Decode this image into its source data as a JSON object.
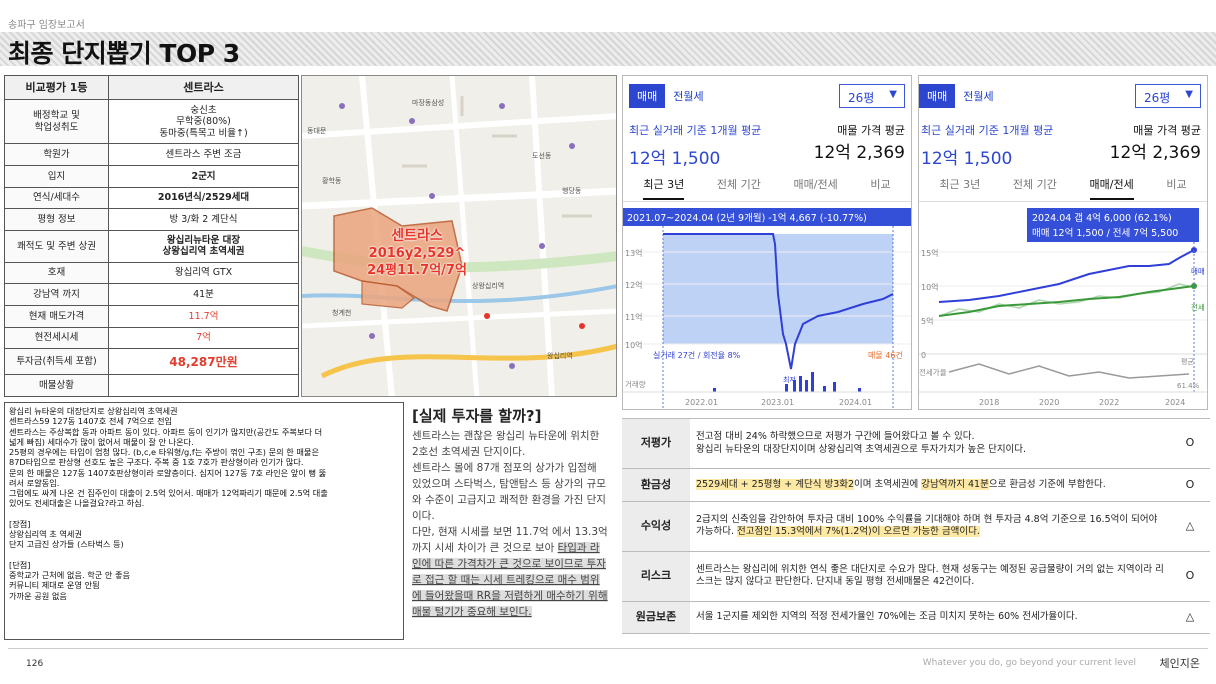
{
  "header": {
    "small_label": "송파구 임장보고서",
    "title": "최종 단지뽑기 TOP 3"
  },
  "comparison": {
    "head_key": "비교평가 1등",
    "head_val": "센트라스",
    "rows": [
      {
        "k": "배정학교 및\n학업성취도",
        "v": "숭신초\n무학중(80%)\n동마중(특목고 비율↑)"
      },
      {
        "k": "학원가",
        "v": "센트라스 주변 조금"
      },
      {
        "k": "입지",
        "v": "2군지"
      },
      {
        "k": "연식/세대수",
        "v": "2016년식/2529세대"
      },
      {
        "k": "평형 정보",
        "v": "방 3/화 2 계단식"
      },
      {
        "k": "쾌적도 및 주변 상권",
        "v": "왕십리뉴타운 대장\n상왕십리역 초역세권"
      },
      {
        "k": "호재",
        "v": "왕십리역 GTX"
      },
      {
        "k": "강남역 까지",
        "v": "41분"
      },
      {
        "k": "현재 매도가격",
        "v": "11.7억"
      },
      {
        "k": "현전세시세",
        "v": "7억"
      },
      {
        "k": "투자금(취득세 포함)",
        "v": "48,287만원"
      },
      {
        "k": "매물상황",
        "v": ""
      }
    ]
  },
  "map": {
    "label_line1": "센트라스",
    "label_line2": "2016y2,529^",
    "label_line3": "24평11.7억/7억",
    "places": [
      "마장동삼성",
      "상왕십리역",
      "왕십리역",
      "도선동",
      "황학동",
      "행당동",
      "청계천",
      "동대문"
    ]
  },
  "panel1": {
    "tab_sale": "매매",
    "tab_rent": "전월세",
    "size": "26평",
    "avg_label": "최근 실거래 기준 1개월 평균",
    "avg_value": "12억 1,500",
    "ask_label": "매물 가격 평균",
    "ask_value": "12억 2,369",
    "period_tabs": [
      "최근 3년",
      "전체 기간",
      "매매/전세",
      "비교"
    ],
    "active_tab": 0,
    "tooltip": "2021.07~2024.04 (2년 9개월)  -1억 4,667 (-10.77%)",
    "y_ticks": [
      "13억",
      "12억",
      "11억",
      "10억"
    ],
    "x_ticks": [
      "2022.01",
      "2023.01",
      "2024.01"
    ],
    "footer_left": "실거래 27건 / 회전율 8%",
    "footer_right": "매물 46건",
    "volume_label": "거래량",
    "min_label": "최저"
  },
  "panel2": {
    "tab_sale": "매매",
    "tab_rent": "전월세",
    "size": "26평",
    "avg_label": "최근 실거래 기준 1개월 평균",
    "avg_value": "12억 1,500",
    "ask_label": "매물 가격 평균",
    "ask_value": "12억 2,369",
    "period_tabs": [
      "최근 3년",
      "전체 기간",
      "매매/전세",
      "비교"
    ],
    "active_tab": 2,
    "tooltip_line1": "2024.04  갭 4억 6,000 (62.1%)",
    "tooltip_line2": "매매 12억 1,500 / 전세 7억 5,500",
    "y_ticks": [
      "15억",
      "10억",
      "5억",
      "0"
    ],
    "x_ticks": [
      "2018",
      "2020",
      "2022",
      "2024"
    ],
    "legend_sale": "매매",
    "legend_rent": "전세",
    "ratio_label": "전세가율",
    "ratio_avg_label": "평균",
    "ratio_avg_value": "61.4%"
  },
  "notes": {
    "text": "왕십리 뉴타운의 대장단지로 상왕십리역 초역세권\n센트라스59 127동 1407호 전세 7억으로 전입\n센트라스는 주상복합 동과 아파트 동이 있다. 아파트 동이 인기가 많지만(공간도 주복보다 더\n넓게 빠짐) 세대수가 많이 없어서 매물이 잘 안 나온다.\n25평의 경우에는 타입이 엄청 많다. (b,c,e 타워형/g,f는 주방이 꺾인 구조) 문의 한 매물은\n87D타입으로 판상형 선호도 높은 구조다. 주복 중 1호 7호가 판상형이라 인기가 많다.\n문의 한 매물은 127동 1407호판상형이라 로얄층이다. 심지어 127동 7호 라인은 앞이 뻥 뚫\n려서 로얄동임.\n그럼에도 싸게 나온 건 집주인이 대출이 2.5억 있어서. 매매가 12억짜리기 때문에 2.5억 대출\n있어도 전세대출은 나올걸요?라고 하심.\n\n[장점]\n상왕십리역 초 역세권\n단지 고급진 상가들 (스타벅스 등)\n\n[단점]\n중학교가 근처에 없음. 학군 안 좋음\n커뮤니티 제대로 운영 안됨\n가까운 공원 없음"
  },
  "question": {
    "title": "[실제 투자를 할까?]",
    "p1": "센트라스는 괜찮은 왕십리 뉴타운에 위치한 2호선 초역세권 단지이다.",
    "p2": "센트라스 몰에 87개 점포의 상가가 입점해 있었으며 스타벅스, 탐앤탐스 등 상가의 규모와 수준이 고급지고 쾌적한 환경을 가진 단지이다.",
    "p3_plain": "다만, 현재 시세를 보면 11.7억 에서 13.3억까지 시세 차이가 큰 것으로 보아 ",
    "p3_underline": "타입과 라인에 따른 가격차가 큰 것으로 보이므로 투자로 접근 할 때는 시세 트레킹으로 매수 범위에 들어왔을때 RR을 저렴하게 매수하기 위해 매물 털기가 중요해 보인다."
  },
  "evaluation": [
    {
      "k": "저평가",
      "text": "전고점 대비 24% 하락했으므로 저평가 구간에 들어왔다고 볼 수 있다.\n왕십리 뉴타운의 대장단지이며 상왕십리역 초역세권으로 투자가치가 높은 단지이다.",
      "mark": "O"
    },
    {
      "k": "환금성",
      "hl1": "2529세대  + 25평형 + 계단식  방3화2",
      "mid": "이며 초역세권에  ",
      "hl2": "강남역까지  41분",
      "tail": "으로 환금성 기준에 부합한다.",
      "mark": "O"
    },
    {
      "k": "수익성",
      "pre": "2급지의 신축임을 감안하여 투자금 대비 100% 수익률을 기대해야 하며 현 투자금 4.8억 기준으로 16.5억이 되어야 가능하다. ",
      "hl1": "전고점인 15.3억에서 7%(1.2억)이 오르면 가능한 금액이다.",
      "mark": "△"
    },
    {
      "k": "리스크",
      "text": "센트라스는 왕십리에 위치한 연식 좋은 대단지로 수요가 많다. 현재 성동구는 예정된 공급물량이 거의 없는 지역이라 리스크는 많지 않다고 판단한다. 단지내 동일 평형 전세매물은 42건이다.",
      "mark": "O"
    },
    {
      "k": "원금보존",
      "text": "서울 1군지를 제외한 지역의 적정 전세가율인 70%에는 조금 미치지 못하는 60% 전세가율이다.",
      "mark": "△"
    }
  ],
  "footer": {
    "page": "126",
    "slogan": "Whatever you do, go beyond your current level",
    "brand": "체인지온"
  },
  "colors": {
    "accent": "#2c46d0",
    "red": "#e23c2c",
    "highlight": "#fde9a3",
    "sale_line": "#2f3fd8",
    "rent_line": "#3a9a3a"
  }
}
